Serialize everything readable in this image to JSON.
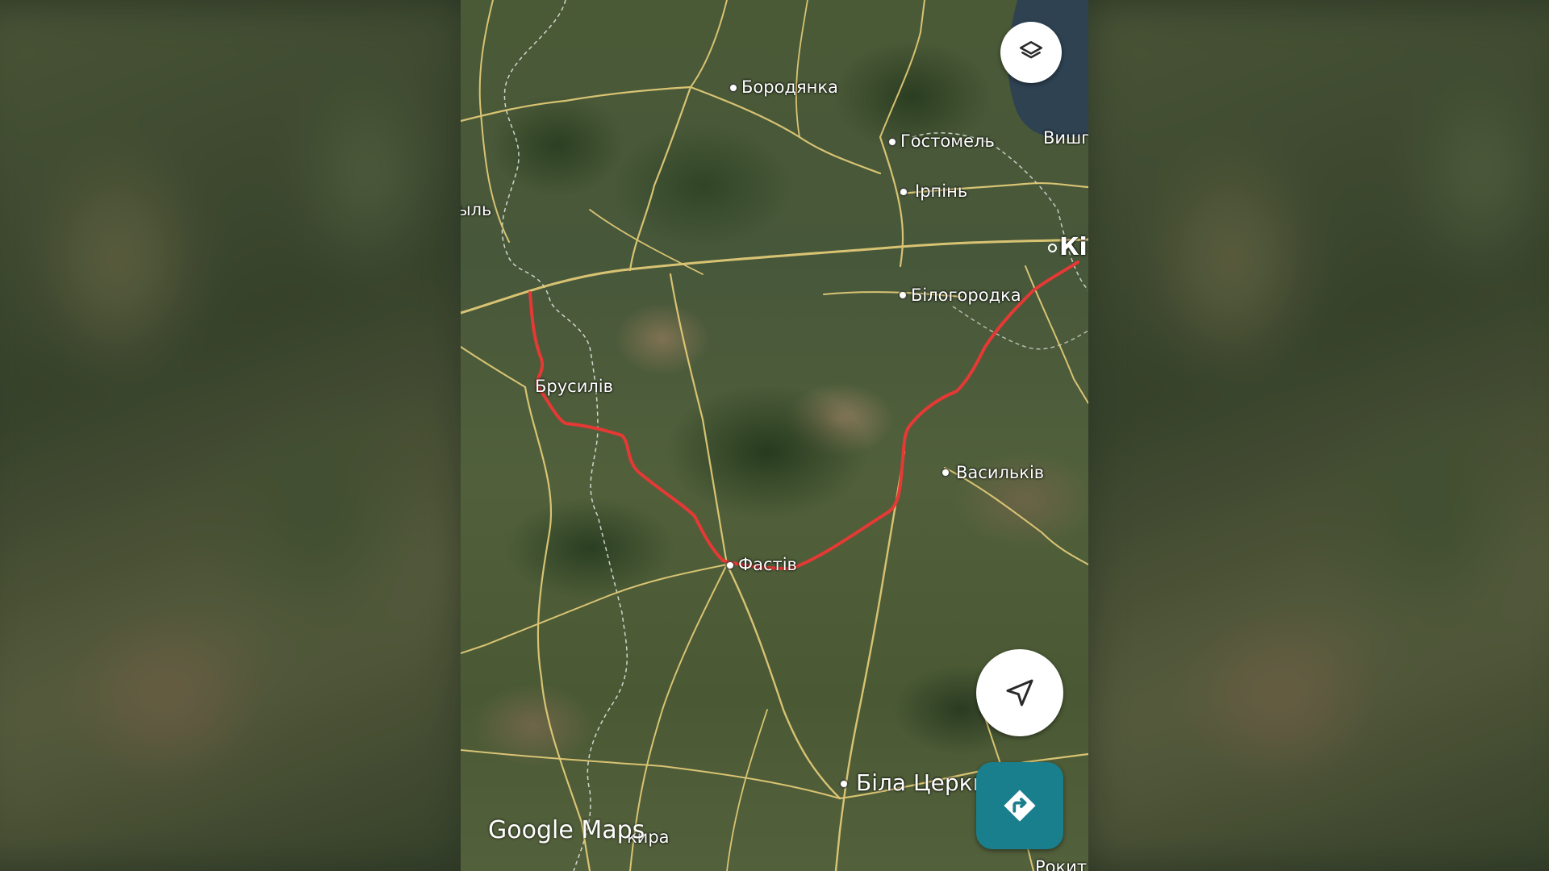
{
  "app": {
    "watermark": "Google Maps"
  },
  "map": {
    "places": {
      "borodianka": "Бородянка",
      "hostomel": "Гостомель",
      "vyshhorod": "Вишг",
      "irpin": "Ірпінь",
      "kyiv": "Кі",
      "west_edge": "ыль",
      "bilohorodka": "Білогородка",
      "brusyliv": "Брусилів",
      "vasylkiv": "Васильків",
      "fastiv": "Фастів",
      "bila_tserkva": "Біла Церкв",
      "bottom_left": "кира",
      "rokytne": "Рокит"
    },
    "route_color": "#e53935",
    "road_color": "#e8cf7a"
  },
  "controls": {
    "layers_icon": "layers-icon",
    "navigate_icon": "navigation-arrow-icon",
    "directions_icon": "directions-turn-icon",
    "directions_color": "#1a7f8d"
  }
}
